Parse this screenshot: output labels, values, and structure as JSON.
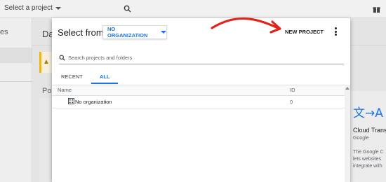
{
  "topbar": {
    "project_select_label": "Select a project"
  },
  "leftnav": {
    "partial_label": "es"
  },
  "main": {
    "title_partial": "Das",
    "popular_label_partial": "Po"
  },
  "side_card": {
    "logo_text": "文→A",
    "title": "Cloud Trans",
    "subtitle": "Google",
    "description_lines": [
      "The Google C",
      "lets websites",
      "integrate with"
    ]
  },
  "dialog": {
    "title": "Select from",
    "org_dropdown_value": "NO ORGANIZATION",
    "new_project_label": "NEW PROJECT",
    "search_placeholder": "Search projects and folders",
    "tabs": [
      {
        "label": "RECENT",
        "active": false
      },
      {
        "label": "ALL",
        "active": true
      }
    ],
    "table": {
      "columns": [
        "Name",
        "ID"
      ],
      "rows": [
        {
          "name": "No organization",
          "id": "0",
          "icon": "building-icon"
        }
      ]
    }
  },
  "colors": {
    "accent": "#1a73e8",
    "annotation": "#e2231a",
    "warning": "#f2b600"
  }
}
